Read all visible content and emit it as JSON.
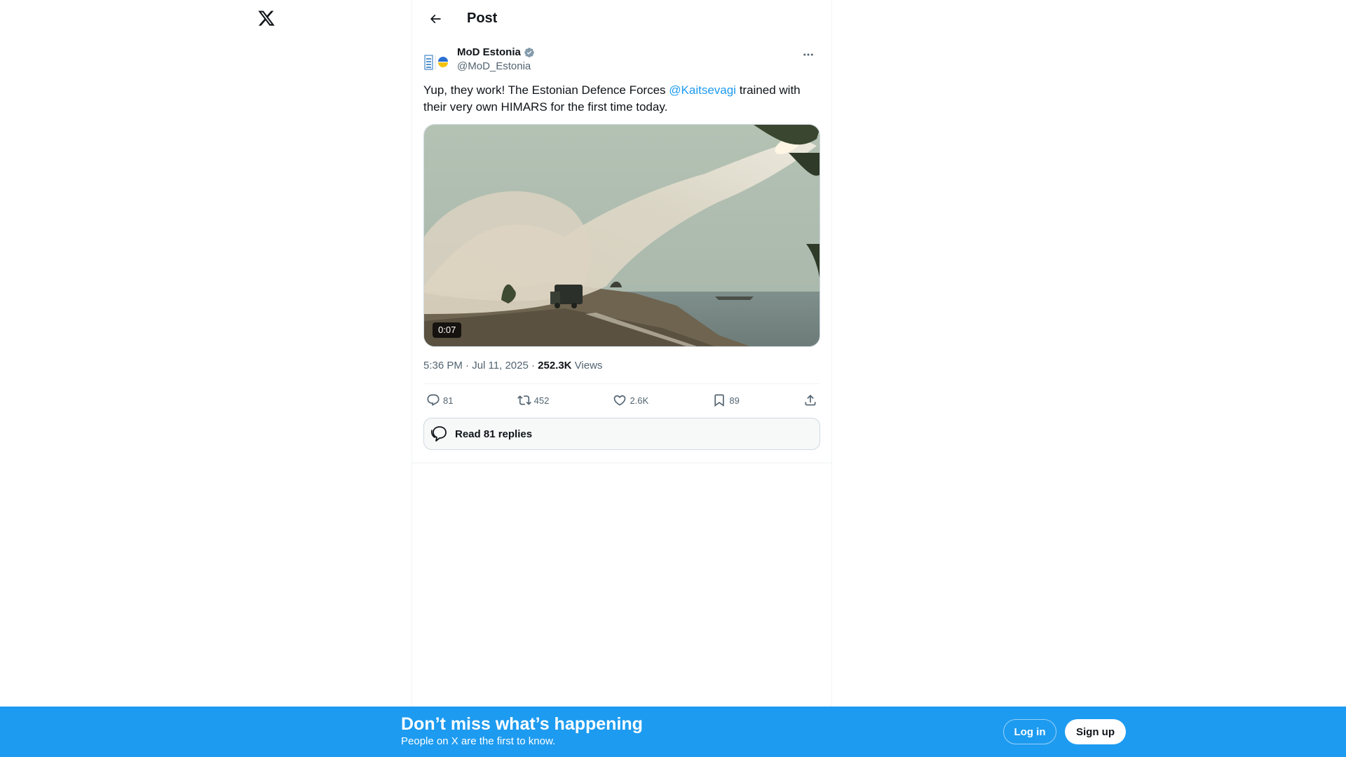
{
  "header": {
    "title": "Post"
  },
  "post": {
    "author_name": "MoD Estonia",
    "author_handle": "@MoD_Estonia",
    "text_before_mention": "Yup, they work!  The Estonian Defence Forces ",
    "mention": "@Kaitsevagi",
    "text_after_mention": " trained with their very own HIMARS for the first time today.",
    "video_duration": "0:07",
    "time": "5:36 PM · Jul 11, 2025 · ",
    "views_count": "252.3K",
    "views_label": " Views"
  },
  "actions": {
    "replies": "81",
    "reposts": "452",
    "likes": "2.6K",
    "bookmarks": "89"
  },
  "read_replies_label": "Read 81 replies",
  "banner": {
    "title": "Don’t miss what’s happening",
    "subtitle": "People on X are the first to know.",
    "login_label": "Log in",
    "signup_label": "Sign up"
  },
  "colors": {
    "accent": "#1d9bf0",
    "text": "#0f1419",
    "muted": "#536471",
    "verified": "#829aab"
  },
  "icons": [
    "x-logo-icon",
    "back-arrow-icon",
    "verified-badge-icon",
    "more-icon",
    "reply-icon",
    "repost-icon",
    "like-icon",
    "bookmark-icon",
    "share-icon",
    "chat-bubbles-icon"
  ]
}
